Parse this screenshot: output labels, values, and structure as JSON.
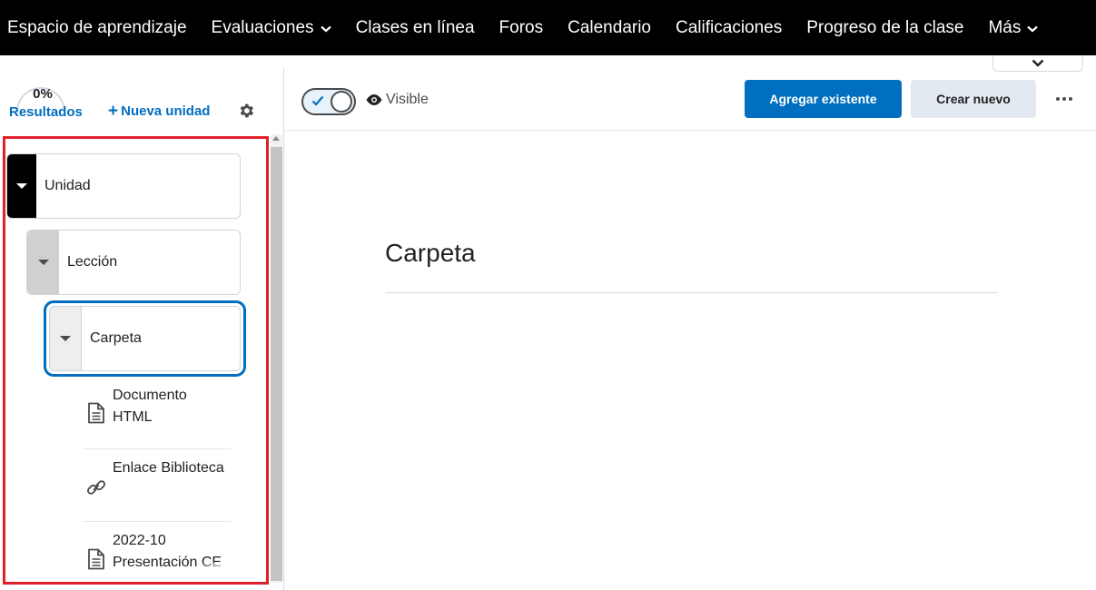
{
  "topnav": {
    "items": [
      {
        "label": "Espacio de aprendizaje",
        "dropdown": false
      },
      {
        "label": "Evaluaciones",
        "dropdown": true
      },
      {
        "label": "Clases en línea",
        "dropdown": false
      },
      {
        "label": "Foros",
        "dropdown": false
      },
      {
        "label": "Calendario",
        "dropdown": false
      },
      {
        "label": "Calificaciones",
        "dropdown": false
      },
      {
        "label": "Progreso de la clase",
        "dropdown": false
      },
      {
        "label": "Más",
        "dropdown": true
      }
    ]
  },
  "sidebar": {
    "progress_percent": "0%",
    "results_label": "Resultados",
    "new_unit_label": "Nueva unidad",
    "tree": {
      "unit": "Unidad",
      "lesson": "Lección",
      "folder": "Carpeta",
      "items": [
        {
          "label": "Documento HTML",
          "icon": "document-icon"
        },
        {
          "label": "Enlace Biblioteca",
          "icon": "link-icon"
        },
        {
          "label": "2022-10 Presentación CE",
          "icon": "document-icon"
        }
      ]
    }
  },
  "toolbar": {
    "visibility_label": "Visible",
    "add_existing_label": "Agregar existente",
    "create_new_label": "Crear nuevo"
  },
  "main": {
    "title": "Carpeta"
  },
  "colors": {
    "nav_bg": "#000000",
    "accent": "#006fbf",
    "highlight_border": "#e0202a"
  }
}
